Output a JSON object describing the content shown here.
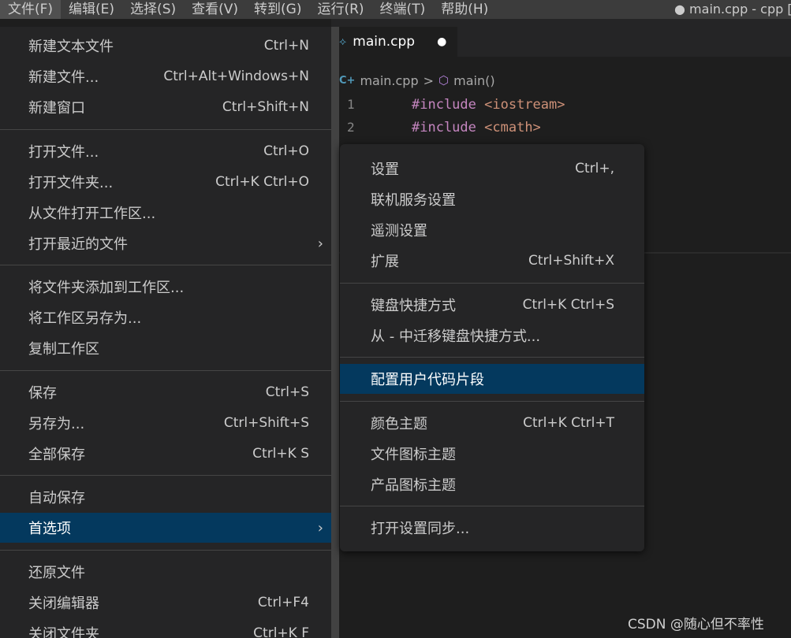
{
  "menubar": {
    "items": [
      "文件(F)",
      "编辑(E)",
      "选择(S)",
      "查看(V)",
      "转到(G)",
      "运行(R)",
      "终端(T)",
      "帮助(H)"
    ],
    "window_title": "● main.cpp - cpp [S"
  },
  "editor": {
    "tab": {
      "label": "main.cpp",
      "icon": "cpp-file-icon",
      "dirty_marker": "●"
    },
    "breadcrumb": {
      "file": "main.cpp",
      "symbol": "main()",
      "file_icon": "C+",
      "separator": ">"
    },
    "lines": [
      {
        "num": "1",
        "keyword": "#include",
        "target": "<iostream>"
      },
      {
        "num": "2",
        "keyword": "#include",
        "target": "<cmath>"
      }
    ]
  },
  "file_menu": {
    "items": [
      {
        "label": "新建文本文件",
        "shortcut": "Ctrl+N"
      },
      {
        "label": "新建文件...",
        "shortcut": "Ctrl+Alt+Windows+N"
      },
      {
        "label": "新建窗口",
        "shortcut": "Ctrl+Shift+N"
      },
      {
        "label": "打开文件...",
        "shortcut": "Ctrl+O"
      },
      {
        "label": "打开文件夹...",
        "shortcut": "Ctrl+K Ctrl+O"
      },
      {
        "label": "从文件打开工作区...",
        "shortcut": ""
      },
      {
        "label": "打开最近的文件",
        "shortcut": ""
      },
      {
        "label": "将文件夹添加到工作区...",
        "shortcut": ""
      },
      {
        "label": "将工作区另存为...",
        "shortcut": ""
      },
      {
        "label": "复制工作区",
        "shortcut": ""
      },
      {
        "label": "保存",
        "shortcut": "Ctrl+S"
      },
      {
        "label": "另存为...",
        "shortcut": "Ctrl+Shift+S"
      },
      {
        "label": "全部保存",
        "shortcut": "Ctrl+K S"
      },
      {
        "label": "自动保存",
        "shortcut": ""
      },
      {
        "label": "首选项",
        "shortcut": ""
      },
      {
        "label": "还原文件",
        "shortcut": ""
      },
      {
        "label": "关闭编辑器",
        "shortcut": "Ctrl+F4"
      },
      {
        "label": "关闭文件夹",
        "shortcut": "Ctrl+K F"
      }
    ],
    "submenu_arrow": "›"
  },
  "preferences_menu": {
    "items": [
      {
        "label": "设置",
        "shortcut": "Ctrl+,"
      },
      {
        "label": "联机服务设置",
        "shortcut": ""
      },
      {
        "label": "遥测设置",
        "shortcut": ""
      },
      {
        "label": "扩展",
        "shortcut": "Ctrl+Shift+X"
      },
      {
        "label": "键盘快捷方式",
        "shortcut": "Ctrl+K Ctrl+S"
      },
      {
        "label": "从 - 中迁移键盘快捷方式...",
        "shortcut": ""
      },
      {
        "label": "配置用户代码片段",
        "shortcut": ""
      },
      {
        "label": "颜色主题",
        "shortcut": "Ctrl+K Ctrl+T"
      },
      {
        "label": "文件图标主题",
        "shortcut": ""
      },
      {
        "label": "产品图标主题",
        "shortcut": ""
      },
      {
        "label": "打开设置同步...",
        "shortcut": ""
      }
    ]
  },
  "watermark": "CSDN @随心但不率性",
  "colors": {
    "highlight": "#04395e",
    "menu_bg": "#252526",
    "editor_bg": "#1e1e1e"
  }
}
